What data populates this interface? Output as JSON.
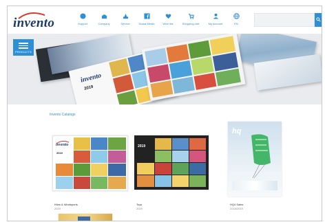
{
  "header": {
    "logo_text": "invento",
    "nav": [
      {
        "label": "Support",
        "icon": "chat-bubble-icon"
      },
      {
        "label": "Company",
        "icon": "company-icon"
      },
      {
        "label": "Service",
        "icon": "service-icon"
      },
      {
        "label": "Social Media",
        "icon": "facebook-icon"
      },
      {
        "label": "Wish list",
        "icon": "heart-icon"
      },
      {
        "label": "Shopping cart",
        "icon": "cart-icon"
      },
      {
        "label": "My Account",
        "icon": "user-icon"
      },
      {
        "label": "EN",
        "icon": "globe-icon"
      }
    ],
    "search": {
      "placeholder": "",
      "button_label": "Q"
    }
  },
  "hero": {
    "products_label": "PRODUCTS",
    "catalog_logo": "invento",
    "catalog_year": "2019"
  },
  "section": {
    "title": "Invento Catalogs",
    "catalogs": [
      {
        "title": "Kites & Windsports",
        "year": "2019",
        "cover_text": "invento",
        "cover_year": "2019"
      },
      {
        "title": "Toys",
        "year": "2019",
        "cover_text": "",
        "cover_year": "2019"
      },
      {
        "title": "HQ4 Sales",
        "year": "2018/2019",
        "cover_text": "hq",
        "cover_year": ""
      }
    ]
  },
  "colors": {
    "accent": "#2d8fd8",
    "brand": "#1e3a6a",
    "logo_swoosh": "#d63a2f"
  }
}
